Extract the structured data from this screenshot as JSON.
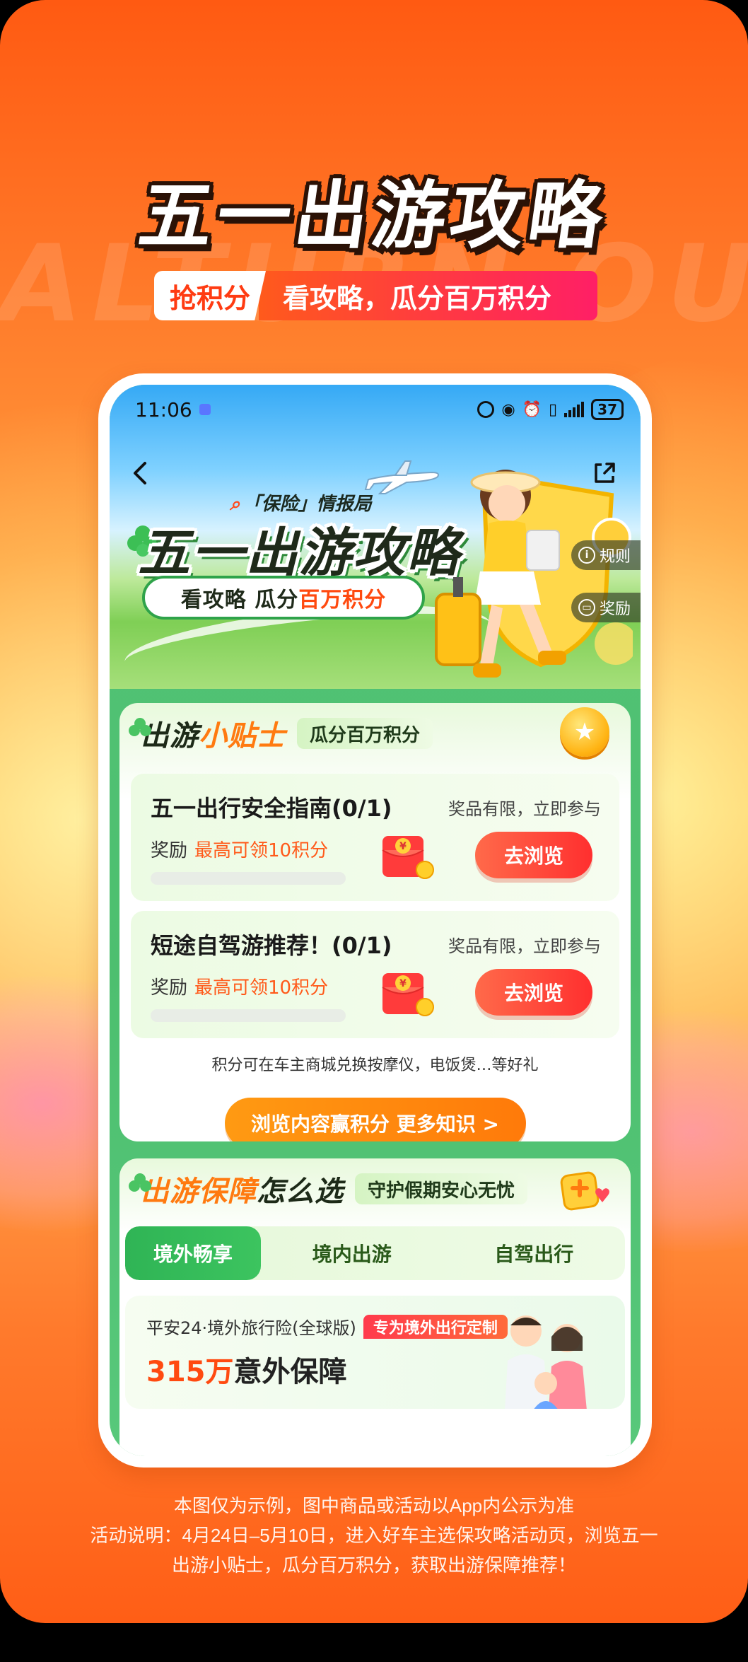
{
  "poster": {
    "watermark": "ALTURN OUR",
    "title": "五一出游攻略",
    "tag": "抢积分",
    "slogan": "看攻略，瓜分百万积分"
  },
  "status_bar": {
    "time": "11:06",
    "battery": "37"
  },
  "banner": {
    "brand": "「保险」情报局",
    "title": "五一出游攻略",
    "sub_prefix": "看攻略 瓜分",
    "sub_highlight": "百万积分",
    "rules_label": "规则",
    "reward_label": "奖励"
  },
  "tips": {
    "title_a": "出游",
    "title_b": "小贴士",
    "pill": "瓜分百万积分",
    "tasks": [
      {
        "title": "五一出行安全指南(0/1)",
        "note": "奖品有限，立即参与",
        "reward_label": "奖励",
        "reward_amount": "最高可领10积分",
        "progress": 0,
        "button": "去浏览"
      },
      {
        "title": "短途自驾游推荐！(0/1)",
        "note": "奖品有限，立即参与",
        "reward_label": "奖励",
        "reward_amount": "最高可领10积分",
        "progress": 0,
        "button": "去浏览"
      }
    ],
    "redeem_note": "积分可在车主商城兑换按摩仪，电饭煲…等好礼",
    "cta": "浏览内容赢积分 更多知识 >"
  },
  "guard": {
    "title_a": "出游保障",
    "title_b": "怎么选",
    "pill": "守护假期安心无忧",
    "tabs": [
      "境外畅享",
      "境内出游",
      "自驾出行"
    ],
    "active_tab": 0,
    "product": {
      "name": "平安24·境外旅行险(全球版)",
      "tag": "专为境外出行定制",
      "main_num": "315万",
      "main_text": "意外保障"
    }
  },
  "footer": {
    "line1": "本图仅为示例，图中商品或活动以App内公示为准",
    "line2": "活动说明：4月24日–5月10日，进入好车主选保攻略活动页，浏览五一",
    "line3": "出游小贴士，瓜分百万积分，获取出游保障推荐！"
  },
  "colors": {
    "accent_orange": "#ff5a12",
    "accent_green": "#2fb455",
    "accent_red": "#ff2f2f"
  }
}
